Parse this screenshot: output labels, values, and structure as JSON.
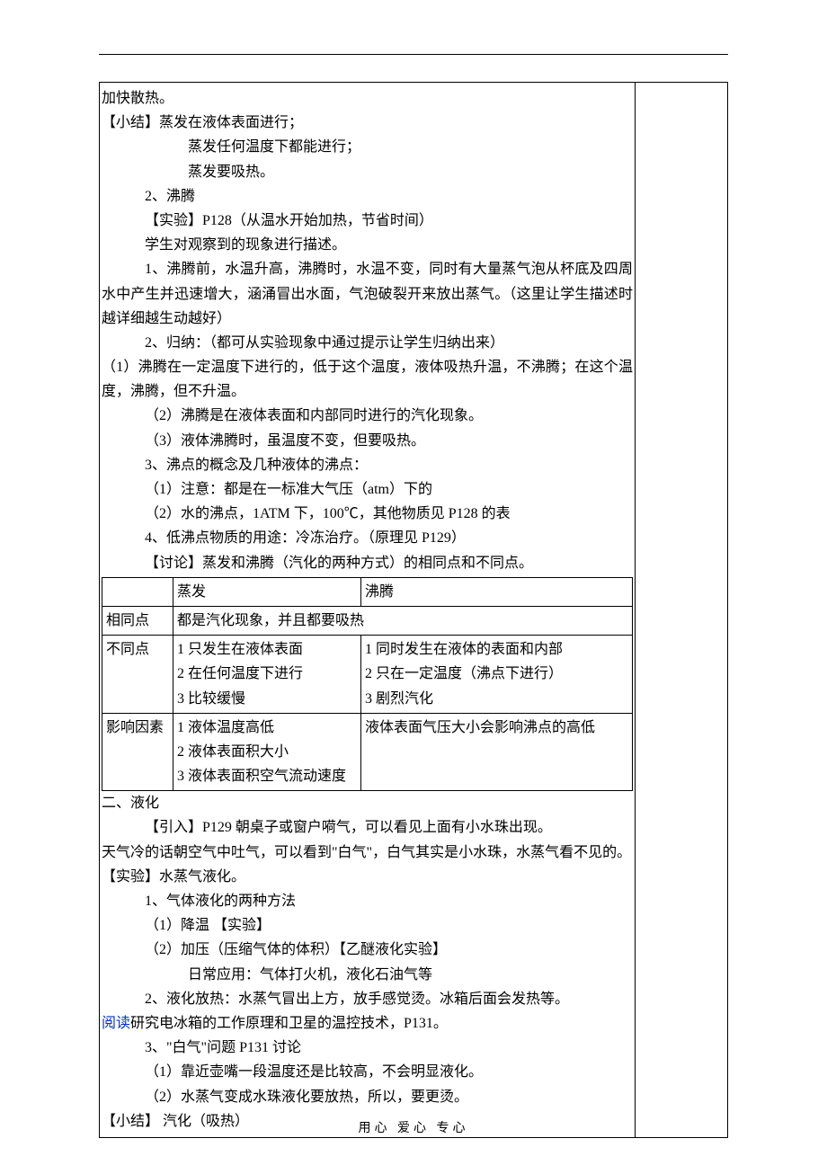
{
  "lines": {
    "l1": "加快散热。",
    "l2": "【小结】蒸发在液体表面进行；",
    "l3": "蒸发任何温度下都能进行；",
    "l4": "蒸发要吸热。",
    "l5": "2、沸腾",
    "l6": "【实验】P128（从温水开始加热，节省时间）",
    "l7": "学生对观察到的现象进行描述。",
    "l8": "1、沸腾前，水温升高，沸腾时，水温不变，同时有大量蒸气泡从杯底及四周水中产生并迅速增大，涵涌冒出水面，气泡破裂开来放出蒸气。（这里让学生描述时越详细越生动越好）",
    "l9": "2、归纳：（都可从实验现象中通过提示让学生归纳出来）",
    "l10": "（1）沸腾在一定温度下进行的，低于这个温度，液体吸热升温，不沸腾；在这个温度，沸腾，但不升温。",
    "l11": "（2）沸腾是在液体表面和内部同时进行的汽化现象。",
    "l12": "（3）液体沸腾时，虽温度不变，但要吸热。",
    "l13": "3、沸点的概念及几种液体的沸点：",
    "l14": "（1）注意：都是在一标准大气压（atm）下的",
    "l15": "（2）水的沸点，1ATM 下，100℃，其他物质见 P128 的表",
    "l16": "4、低沸点物质的用途：冷冻治疗。（原理见 P129）",
    "l17": "【讨论】蒸发和沸腾（汽化的两种方式）的相同点和不同点。"
  },
  "table": {
    "header": {
      "c1": "蒸发",
      "c2": "沸腾"
    },
    "row1": {
      "label": "相同点",
      "value": "都是汽化现象，并且都要吸热"
    },
    "row2": {
      "label": "不同点",
      "c1_1": "1 只发生在液体表面",
      "c1_2": "2 在任何温度下进行",
      "c1_3": "3 比较缓慢",
      "c2_1": "1 同时发生在液体的表面和内部",
      "c2_2": "2 只在一定温度（沸点下进行）",
      "c2_3": "3 剧烈汽化"
    },
    "row3": {
      "label": "影响因素",
      "c1_1": "1 液体温度高低",
      "c1_2": "2 液体表面积大小",
      "c1_3": "3 液体表面积空气流动速度",
      "c2": "液体表面气压大小会影响沸点的高低"
    }
  },
  "lines2": {
    "s1": "二、液化",
    "s2": "【引入】P129 朝桌子或窗户嗬气，可以看见上面有小水珠出现。",
    "s3": "天气冷的话朝空气中吐气，可以看到\"白气\"，白气其实是小水珠，水蒸气看不见的。",
    "s4": "【实验】水蒸气液化。",
    "s5": "1、气体液化的两种方法",
    "s6": "（1）降温    【实验】",
    "s7": "（2）加压（压缩气体的体积）【乙醚液化实验】",
    "s8": "日常应用：气体打火机，液化石油气等",
    "s9": "2、液化放热：水蒸气冒出上方，放手感觉烫。冰箱后面会发热等。",
    "s10a": "阅读",
    "s10b": "研究电冰箱的工作原理和卫星的温控技术，P131。",
    "s11": "3、\"白气\"问题 P131 讨论",
    "s12": "（1）靠近壶嘴一段温度还是比较高，不会明显液化。",
    "s13": "（2）水蒸气变成水珠液化要放热，所以，要更烫。",
    "s14": "【小结】                     汽化（吸热）"
  },
  "footer": "用心  爱心  专心"
}
